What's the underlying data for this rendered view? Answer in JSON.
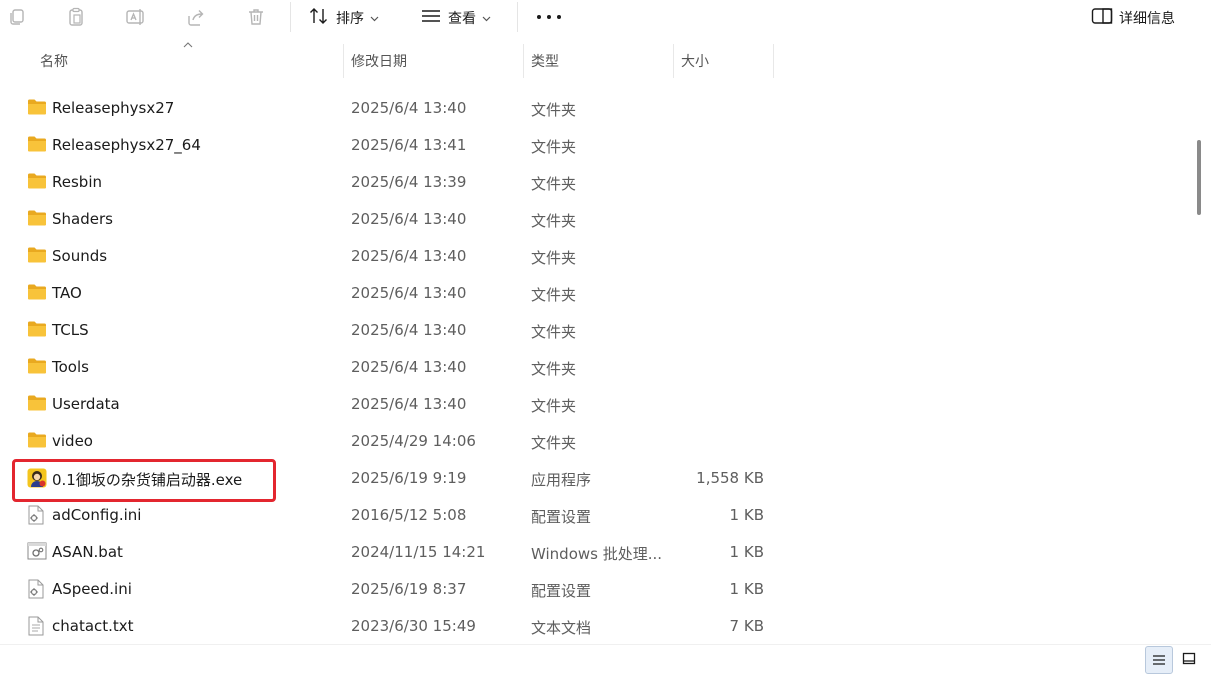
{
  "toolbar": {
    "sort_label": "排序",
    "view_label": "查看",
    "details_label": "详细信息"
  },
  "columns": {
    "name": "名称",
    "date": "修改日期",
    "type": "类型",
    "size": "大小"
  },
  "files": [
    {
      "name": "Releasephysx27",
      "date": "2025/6/4 13:40",
      "type": "文件夹",
      "size": "",
      "icon": "folder-icon"
    },
    {
      "name": "Releasephysx27_64",
      "date": "2025/6/4 13:41",
      "type": "文件夹",
      "size": "",
      "icon": "folder-icon"
    },
    {
      "name": "Resbin",
      "date": "2025/6/4 13:39",
      "type": "文件夹",
      "size": "",
      "icon": "folder-icon"
    },
    {
      "name": "Shaders",
      "date": "2025/6/4 13:40",
      "type": "文件夹",
      "size": "",
      "icon": "folder-icon"
    },
    {
      "name": "Sounds",
      "date": "2025/6/4 13:40",
      "type": "文件夹",
      "size": "",
      "icon": "folder-icon"
    },
    {
      "name": "TAO",
      "date": "2025/6/4 13:40",
      "type": "文件夹",
      "size": "",
      "icon": "folder-icon"
    },
    {
      "name": "TCLS",
      "date": "2025/6/4 13:40",
      "type": "文件夹",
      "size": "",
      "icon": "folder-icon"
    },
    {
      "name": "Tools",
      "date": "2025/6/4 13:40",
      "type": "文件夹",
      "size": "",
      "icon": "folder-icon"
    },
    {
      "name": "Userdata",
      "date": "2025/6/4 13:40",
      "type": "文件夹",
      "size": "",
      "icon": "folder-icon"
    },
    {
      "name": "video",
      "date": "2025/4/29 14:06",
      "type": "文件夹",
      "size": "",
      "icon": "folder-icon"
    },
    {
      "name": "0.1御坂の杂货铺启动器.exe",
      "date": "2025/6/19 9:19",
      "type": "应用程序",
      "size": "1,558 KB",
      "icon": "app-icon"
    },
    {
      "name": "adConfig.ini",
      "date": "2016/5/12 5:08",
      "type": "配置设置",
      "size": "1 KB",
      "icon": "config-file-icon"
    },
    {
      "name": "ASAN.bat",
      "date": "2024/11/15 14:21",
      "type": "Windows 批处理...",
      "size": "1 KB",
      "icon": "batch-file-icon"
    },
    {
      "name": "ASpeed.ini",
      "date": "2025/6/19 8:37",
      "type": "配置设置",
      "size": "1 KB",
      "icon": "config-file-icon"
    },
    {
      "name": "chatact.txt",
      "date": "2023/6/30 15:49",
      "type": "文本文档",
      "size": "7 KB",
      "icon": "text-file-icon"
    }
  ],
  "colors": {
    "folder": "#F8C33A",
    "highlight": "#E3262F",
    "selected_view": "#E6EEF8"
  }
}
